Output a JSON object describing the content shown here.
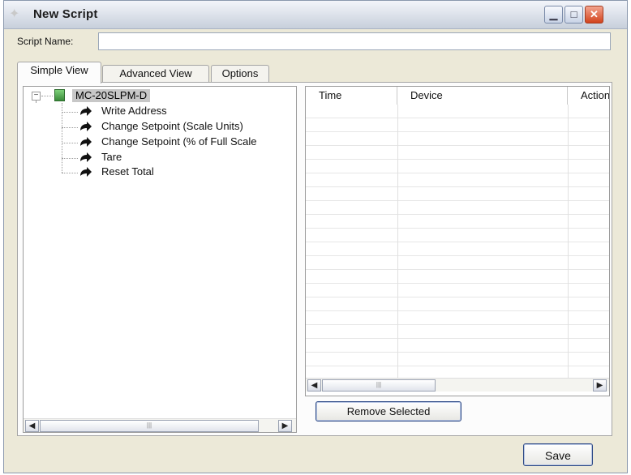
{
  "window": {
    "title": "New Script",
    "icons": {
      "app": "script-icon",
      "minimize": "minimize-icon",
      "maximize": "maximize-icon",
      "close": "close-icon"
    }
  },
  "script_name": {
    "label": "Script Name:",
    "value": ""
  },
  "tabs": [
    {
      "label": "Simple View",
      "active": true
    },
    {
      "label": "Advanced View",
      "active": false
    },
    {
      "label": "Options",
      "active": false
    }
  ],
  "tree": {
    "device": "MC-20SLPM-D",
    "actions": [
      {
        "label": "Write Address"
      },
      {
        "label": "Change Setpoint (Scale Units)"
      },
      {
        "label": "Change Setpoint (% of Full Scale"
      },
      {
        "label": "Tare"
      },
      {
        "label": "Reset Total"
      }
    ]
  },
  "grid": {
    "columns": [
      "Time",
      "Device",
      "Action"
    ],
    "rows": []
  },
  "buttons": {
    "remove_selected": "Remove Selected",
    "save": "Save"
  },
  "scroll": {
    "left_arrow": "◀",
    "right_arrow": "▶",
    "thumb_grip": "|||"
  },
  "colors": {
    "window_bg": "#ece9d8",
    "close_button": "#d2431c",
    "selection_highlight": "#c7c7c7"
  }
}
